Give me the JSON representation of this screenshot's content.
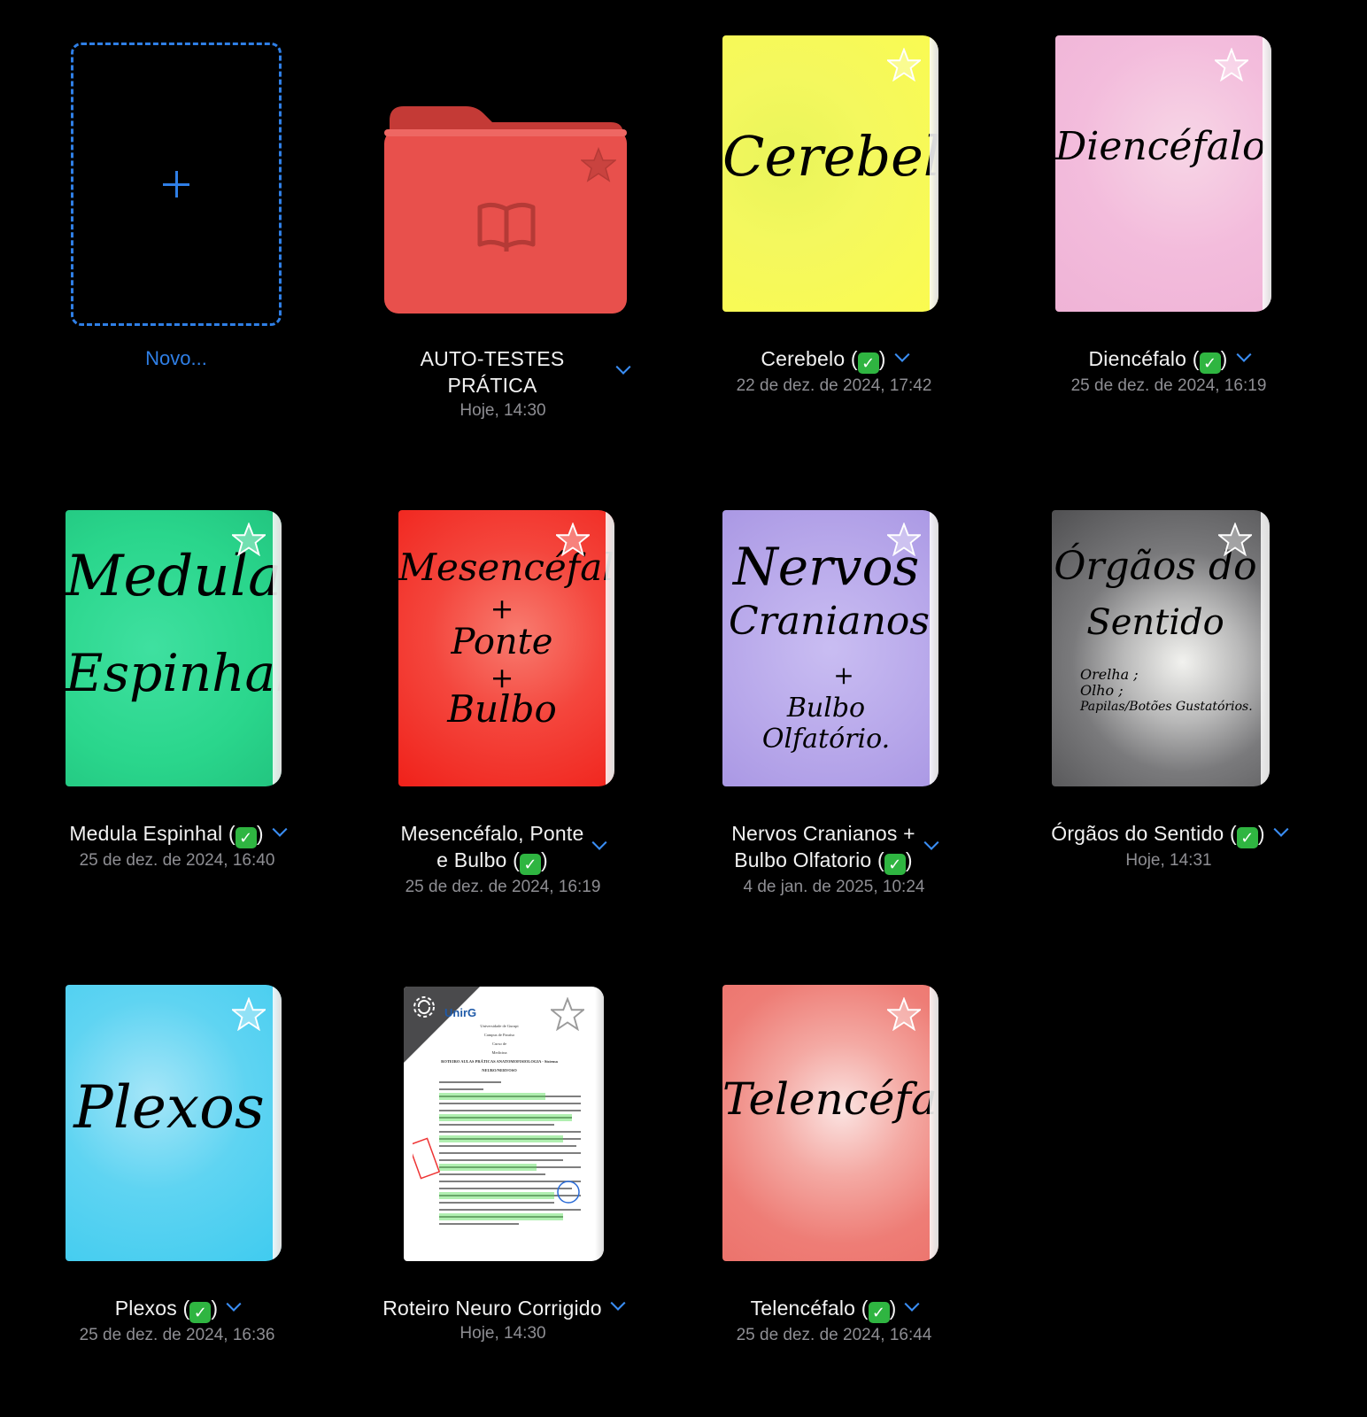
{
  "new_item": {
    "label": "Novo..."
  },
  "items": [
    {
      "title": "AUTO-TESTES PRÁTICA",
      "date": "Hoje, 14:30",
      "kind": "folder",
      "color": "#e8504c"
    },
    {
      "title": "Cerebelo (",
      "title_end": ")",
      "checked": true,
      "date": "22 de dez. de 2024, 17:42",
      "cover_text": "Cerebelo",
      "color": "#f5f557"
    },
    {
      "title": "Diencéfalo (",
      "title_end": ")",
      "checked": true,
      "date": "25 de dez. de 2024, 16:19",
      "cover_text": "Diencéfalo",
      "color": "#f3bfe0"
    },
    {
      "title": "Medula Espinhal (",
      "title_end": ")",
      "checked": true,
      "date": "25 de dez. de 2024, 16:40",
      "cover_text_1": "Medula",
      "cover_text_2": "Espinhal",
      "color": "#2ad68c"
    },
    {
      "title": "Mesencéfalo, Ponte",
      "title_2": "e Bulbo (",
      "title_end": ")",
      "checked": true,
      "date": "25 de dez. de 2024, 16:19",
      "cover_text_1": "Mesencéfalo",
      "cover_text_2": "+",
      "cover_text_3": "Ponte",
      "cover_text_4": "+",
      "cover_text_5": "Bulbo",
      "color": "#f22b22"
    },
    {
      "title": "Nervos Cranianos +",
      "title_2": "Bulbo Olfatorio (",
      "title_end": ")",
      "checked": true,
      "date": "4 de jan. de 2025, 10:24",
      "cover_text_1": "Nervos",
      "cover_text_2": "Cranianos",
      "cover_text_3": "+",
      "cover_text_4": "Bulbo Olfatório.",
      "color": "#b7a7ea"
    },
    {
      "title": "Órgãos do Sentido (",
      "title_end": ")",
      "checked": true,
      "date": "Hoje, 14:31",
      "cover_text_1": "Órgãos do",
      "cover_text_2": "Sentido",
      "cover_text_3": "Orelha ;",
      "cover_text_4": "Olho ;",
      "cover_text_5": "Papilas/Botões Gustatórios.",
      "color": "#5b5b5d"
    },
    {
      "title": "Plexos (",
      "title_end": ")",
      "checked": true,
      "date": "25 de dez. de 2024, 16:36",
      "cover_text": "Plexos",
      "color": "#45cdf0"
    },
    {
      "title": "Roteiro Neuro Corrigido",
      "date": "Hoje, 14:30",
      "kind": "document",
      "doc_header": "UnirG",
      "doc_lines": [
        "Universidade de Gurupi",
        "Campus de Paraíso",
        "Curso de",
        "Medicina",
        "ROTEIRO AULAS PRÁTICAS ANATOMOFISIOLOGIA - Sistema",
        "NEURO/NERVOSO"
      ]
    },
    {
      "title": "Telencéfalo (",
      "title_end": ")",
      "checked": true,
      "date": "25 de dez. de 2024, 16:44",
      "cover_text": "Telencéfalo",
      "color": "#ee7d76"
    }
  ],
  "check_glyph": "✓",
  "icons": {
    "star": "star-icon",
    "chevron": "chevron-down-icon",
    "plus": "plus-icon",
    "book": "book-icon",
    "sync": "sync-icon"
  }
}
